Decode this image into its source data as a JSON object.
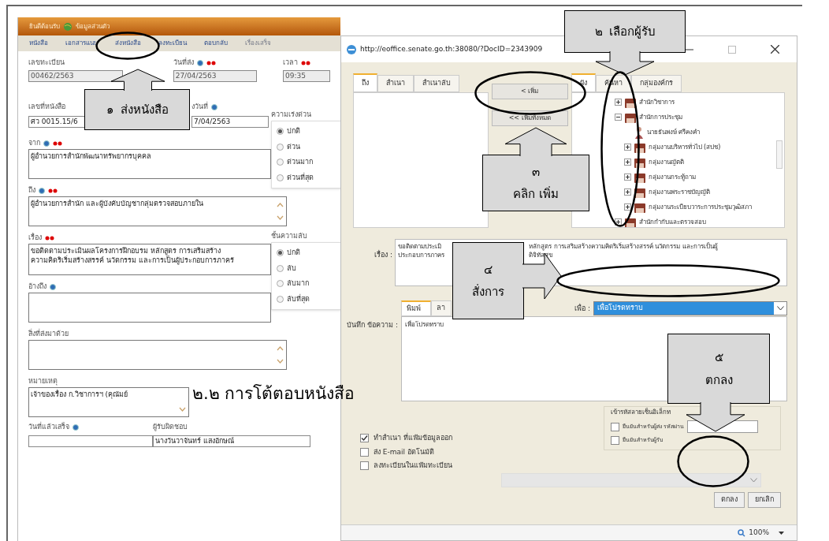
{
  "main_window": {
    "header": {
      "welcome": "ยินดีต้อนรับ",
      "user": "ข้อมูลส่วนตัว"
    },
    "nav": [
      {
        "label": "หนังสือ",
        "disabled": false
      },
      {
        "label": "เอกสารแนบ",
        "disabled": false
      },
      {
        "label": "ส่งหนังสือ",
        "disabled": false
      },
      {
        "label": "ลงทะเบียน",
        "disabled": false
      },
      {
        "label": "ตอบกลับ",
        "disabled": false
      },
      {
        "label": "เรื่องเสร็จ",
        "disabled": true
      }
    ],
    "registration": {
      "label": "เลขทะเบียน",
      "value": "00462/2563",
      "disabled": true
    },
    "send_date": {
      "label": "วันที่ส่ง",
      "value": "27/04/2563",
      "disabled": true
    },
    "time": {
      "label": "เวลา",
      "value": "09:35",
      "disabled": true
    },
    "doc_number": {
      "label": "เลขที่หนังสือ",
      "value": "ศว 0015.15/6"
    },
    "doc_date": {
      "label": "งวันที่",
      "value": "7/04/2563"
    },
    "urgency": {
      "label": "ความเร่งด่วน",
      "options": [
        {
          "label": "ปกติ",
          "selected": true
        },
        {
          "label": "ด่วน",
          "selected": false
        },
        {
          "label": "ด่วนมาก",
          "selected": false
        },
        {
          "label": "ด่วนที่สุด",
          "selected": false
        }
      ]
    },
    "from": {
      "label": "จาก",
      "value": "ผู้อำนวยการสำนักพัฒนาทรัพยากรบุคคล"
    },
    "to": {
      "label": "ถึง",
      "value": "ผู้อำนวยการสำนัก และผู้บังคับบัญชากลุ่มตรวจสอบภายใน"
    },
    "subject": {
      "label": "เรื่อง",
      "lines": [
        "ขอติดตามประเมินผลโครงการฝึกอบรม หลักสูตร การเสริมสร้าง",
        "ความคิดริเริ่มสร้างสรรค์ นวัตกรรม และการเป็นผู้ประกอบการภาครั"
      ]
    },
    "secrecy": {
      "label": "ชั้นความลับ",
      "options": [
        {
          "label": "ปกติ",
          "selected": true
        },
        {
          "label": "ลับ",
          "selected": false
        },
        {
          "label": "ลับมาก",
          "selected": false
        },
        {
          "label": "ลับที่สุด",
          "selected": false
        }
      ]
    },
    "reference": {
      "label": "อ้างถึง"
    },
    "attachments": {
      "label": "สิ่งที่ส่งมาด้วย"
    },
    "remarks": {
      "label": "หมายเหตุ",
      "value": "เจ้าของเรื่อง ก.วิชาการฯ (คุณัมย์"
    },
    "due_date": {
      "label": "วันที่แล้วเสร็จ"
    },
    "responsible": {
      "label": "ผู้รับผิดชอบ",
      "value": "นางวันวาจันทร์ แสงอักษณ์"
    }
  },
  "annotation_title": "๒.๒ การโต้ตอบหนังสือ",
  "callouts": [
    {
      "number": "๑",
      "text": "ส่งหนังสือ",
      "kind": "up"
    },
    {
      "number": "๒",
      "text": "เลือกผู้รับ",
      "kind": "down"
    },
    {
      "number": "๓",
      "text": "คลิก เพิ่ม",
      "kind": "up"
    },
    {
      "number": "๔",
      "text": "สั่งการ",
      "kind": "right"
    },
    {
      "number": "๕",
      "text": "ตกลง",
      "kind": "down"
    }
  ],
  "popup": {
    "url": "http://eoffice.senate.go.th:38080/?DocID=2343909",
    "recipient_tabs": [
      {
        "label": "ถึง",
        "selected": true
      },
      {
        "label": "สำเนา",
        "selected": false
      },
      {
        "label": "สำเนาลับ",
        "selected": false
      }
    ],
    "move_buttons": [
      "< เพิ่ม",
      "<< เพิ่มทั้งหมด"
    ],
    "directory_tabs": [
      {
        "label": "ผัง",
        "selected": true
      },
      {
        "label": "ค้นหา",
        "selected": false
      },
      {
        "label": "กลุ่มองค์กร",
        "selected": false
      }
    ],
    "tree": [
      {
        "label": "สำนักวิชาการ",
        "kind": "group",
        "expanded": false
      },
      {
        "label": "สำนักการประชุม",
        "kind": "group",
        "expanded": true,
        "children": [
          {
            "label": "นายธันพงษ์ ศรีคงคำ",
            "kind": "person"
          },
          {
            "label": "กลุ่มงานบริหารทั่วไป (สปช)",
            "kind": "group",
            "expanded": false
          },
          {
            "label": "กลุ่มงานญัตติ",
            "kind": "group",
            "expanded": false
          },
          {
            "label": "กลุ่มงานกระทู้ถาม",
            "kind": "group",
            "expanded": false
          },
          {
            "label": "กลุ่มงานพระราชบัญญัติ",
            "kind": "group",
            "expanded": false
          },
          {
            "label": "กลุ่มงานระเบียบวาระการประชุมวุฒิสภา",
            "kind": "group",
            "expanded": false
          }
        ]
      },
      {
        "label": "สำนักกำกับและตรวจสอบ",
        "kind": "group",
        "expanded": false
      }
    ],
    "subject": {
      "label": "เรื่อง :",
      "lines": [
        {
          "before": "ขอติดตามประเมิ",
          "after": "หลักสูตร การเสริมสร้างความคิดริเริ่มสร้างสรรค์ นวัตกรรม และการเป็นผู้"
        },
        {
          "before": "ประกอบการภาคร",
          "after": "ดิจิทัลสุข"
        }
      ]
    },
    "memo": {
      "label": "บันทึก ข้อความ :",
      "tabs": [
        {
          "label": "พิมพ์",
          "selected": true
        },
        {
          "label": "ลา",
          "selected": false
        }
      ],
      "purpose_label": "เพื่อ :",
      "purpose": "เพื่อโปรดทราบ",
      "text": "เพื่อโปรดทราบ"
    },
    "signature": {
      "title": "เข้ารหัสลายเซ็นอิเล็กท",
      "options": [
        {
          "label": "ยืนยันสำหรับผู้ส่ง รหัสผ่าน",
          "checked": false,
          "kind": "password"
        },
        {
          "label": "ยืนยันสำหรับผู้รับ",
          "checked": false,
          "kind": "plain"
        }
      ]
    },
    "options": [
      {
        "label": "ทำสำเนา ที่แฟ้มข้อมูลออก",
        "checked": true
      },
      {
        "label": "ส่ง E-mail อัตโนมัติ",
        "checked": false
      },
      {
        "label": "ลงทะเบียนในแฟ้มทะเบียน",
        "checked": false
      }
    ],
    "buttons": [
      "ตกลง",
      "ยกเลิก"
    ],
    "zoom": "100%"
  }
}
